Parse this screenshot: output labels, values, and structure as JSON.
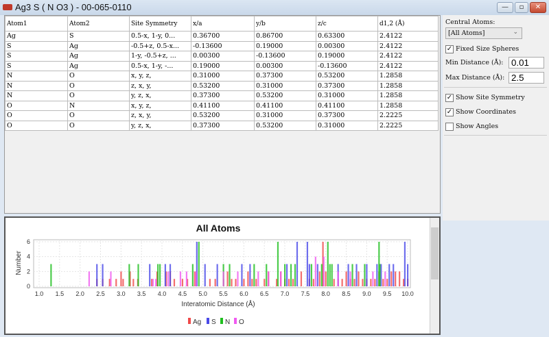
{
  "window": {
    "title": "Ag3 S ( N O3 ) - 00-065-0110",
    "minimize": "—",
    "maximize": "▫",
    "close": "✕"
  },
  "table": {
    "columns": [
      "Atom1",
      "Atom2",
      "Site Symmetry",
      "x/a",
      "y/b",
      "z/c",
      "d1,2 (Å)"
    ],
    "rows": [
      [
        "Ag",
        "S",
        "0.5-x, 1-y, 0...",
        "0.36700",
        "0.86700",
        "0.63300",
        "2.4122"
      ],
      [
        "S",
        "Ag",
        "-0.5+z, 0.5-x...",
        "-0.13600",
        "0.19000",
        "0.00300",
        "2.4122"
      ],
      [
        "S",
        "Ag",
        "1-y, -0.5+z, ...",
        "0.00300",
        "-0.13600",
        "0.19000",
        "2.4122"
      ],
      [
        "S",
        "Ag",
        "0.5-x, 1-y, -...",
        "0.19000",
        "0.00300",
        "-0.13600",
        "2.4122"
      ],
      [
        "N",
        "O",
        "x, y, z,",
        "0.31000",
        "0.37300",
        "0.53200",
        "1.2858"
      ],
      [
        "N",
        "O",
        "z, x, y,",
        "0.53200",
        "0.31000",
        "0.37300",
        "1.2858"
      ],
      [
        "N",
        "O",
        "y, z, x,",
        "0.37300",
        "0.53200",
        "0.31000",
        "1.2858"
      ],
      [
        "O",
        "N",
        "x, y, z,",
        "0.41100",
        "0.41100",
        "0.41100",
        "1.2858"
      ],
      [
        "O",
        "O",
        "z, x, y,",
        "0.53200",
        "0.31000",
        "0.37300",
        "2.2225"
      ],
      [
        "O",
        "O",
        "y, z, x,",
        "0.37300",
        "0.53200",
        "0.31000",
        "2.2225"
      ]
    ]
  },
  "panel": {
    "central_atoms_label": "Central Atoms:",
    "central_atoms_value": "[All Atoms]",
    "fixed_size_spheres": {
      "label": "Fixed Size Spheres",
      "checked": true
    },
    "min_distance_label": "Min Distance (Å):",
    "min_distance_value": "0.01",
    "max_distance_label": "Max Distance (Å):",
    "max_distance_value": "2.5",
    "show_site_symmetry": {
      "label": "Show Site Symmetry",
      "checked": true
    },
    "show_coordinates": {
      "label": "Show Coordinates",
      "checked": true
    },
    "show_angles": {
      "label": "Show Angles",
      "checked": false
    }
  },
  "chart_data": {
    "type": "bar",
    "title": "All Atoms",
    "xlabel": "Interatomic Distance (Å)",
    "ylabel": "Number",
    "xlim": [
      1.0,
      10.0
    ],
    "ylim": [
      0,
      6
    ],
    "xticks": [
      "1.0",
      "1.5",
      "2.0",
      "2.5",
      "3.0",
      "3.5",
      "4.0",
      "4.5",
      "5.0",
      "5.5",
      "6.0",
      "6.5",
      "7.0",
      "7.5",
      "8.0",
      "8.5",
      "9.0",
      "9.5",
      "10.0"
    ],
    "yticks": [
      "0",
      "2",
      "4",
      "6"
    ],
    "grid": true,
    "legend_position": "bottom",
    "series": [
      {
        "name": "Ag",
        "color": "#f04a4a",
        "points": [
          [
            2.41,
            1
          ],
          [
            2.55,
            1
          ],
          [
            2.72,
            1
          ],
          [
            2.88,
            1
          ],
          [
            3.0,
            2
          ],
          [
            3.05,
            1
          ],
          [
            3.22,
            2
          ],
          [
            3.3,
            1
          ],
          [
            3.41,
            1
          ],
          [
            3.75,
            1
          ],
          [
            3.88,
            2
          ],
          [
            4.1,
            2
          ],
          [
            4.2,
            2
          ],
          [
            4.3,
            1
          ],
          [
            4.5,
            1
          ],
          [
            4.62,
            1
          ],
          [
            4.8,
            2
          ],
          [
            5.17,
            1
          ],
          [
            5.3,
            1
          ],
          [
            5.5,
            1
          ],
          [
            5.6,
            2
          ],
          [
            5.7,
            1
          ],
          [
            5.8,
            1
          ],
          [
            6.0,
            1
          ],
          [
            6.1,
            2
          ],
          [
            6.2,
            1
          ],
          [
            6.3,
            1
          ],
          [
            6.5,
            1
          ],
          [
            6.6,
            2
          ],
          [
            6.8,
            1
          ],
          [
            6.9,
            2
          ],
          [
            7.0,
            1
          ],
          [
            7.1,
            1
          ],
          [
            7.2,
            1
          ],
          [
            7.4,
            2
          ],
          [
            7.6,
            1
          ],
          [
            7.7,
            1
          ],
          [
            7.85,
            2
          ],
          [
            7.93,
            6
          ],
          [
            8.0,
            2
          ],
          [
            8.2,
            1
          ],
          [
            8.3,
            1
          ],
          [
            8.4,
            1
          ],
          [
            8.5,
            2
          ],
          [
            8.6,
            1
          ],
          [
            8.7,
            1
          ],
          [
            8.8,
            2
          ],
          [
            8.9,
            1
          ],
          [
            9.0,
            1
          ],
          [
            9.1,
            1
          ],
          [
            9.2,
            1
          ],
          [
            9.3,
            2
          ],
          [
            9.4,
            1
          ],
          [
            9.5,
            1
          ],
          [
            9.6,
            2
          ],
          [
            9.7,
            2
          ],
          [
            9.8,
            2
          ],
          [
            9.9,
            1
          ],
          [
            10.0,
            1
          ]
        ]
      },
      {
        "name": "S",
        "color": "#4a4ae8",
        "points": [
          [
            2.41,
            3
          ],
          [
            2.55,
            3
          ],
          [
            3.7,
            3
          ],
          [
            4.08,
            3
          ],
          [
            4.2,
            3
          ],
          [
            4.85,
            6
          ],
          [
            5.05,
            3
          ],
          [
            5.35,
            3
          ],
          [
            5.95,
            3
          ],
          [
            6.15,
            3
          ],
          [
            7.05,
            3
          ],
          [
            7.3,
            6
          ],
          [
            7.55,
            6
          ],
          [
            7.6,
            3
          ],
          [
            7.8,
            3
          ],
          [
            8.3,
            3
          ],
          [
            8.55,
            3
          ],
          [
            8.75,
            3
          ],
          [
            9.0,
            3
          ],
          [
            9.25,
            3
          ],
          [
            9.35,
            3
          ],
          [
            9.55,
            3
          ],
          [
            9.65,
            3
          ],
          [
            9.93,
            6
          ],
          [
            10.0,
            3
          ]
        ]
      },
      {
        "name": "N",
        "color": "#1fbf1f",
        "points": [
          [
            1.29,
            3
          ],
          [
            3.2,
            3
          ],
          [
            3.42,
            3
          ],
          [
            3.9,
            3
          ],
          [
            3.95,
            3
          ],
          [
            4.75,
            3
          ],
          [
            4.9,
            6
          ],
          [
            5.5,
            3
          ],
          [
            5.65,
            3
          ],
          [
            6.25,
            3
          ],
          [
            6.55,
            3
          ],
          [
            6.83,
            6
          ],
          [
            7.0,
            3
          ],
          [
            7.15,
            3
          ],
          [
            7.25,
            3
          ],
          [
            7.65,
            3
          ],
          [
            7.9,
            3
          ],
          [
            8.05,
            6
          ],
          [
            8.1,
            3
          ],
          [
            8.15,
            3
          ],
          [
            8.65,
            3
          ],
          [
            8.95,
            3
          ],
          [
            9.3,
            6
          ],
          [
            9.32,
            3
          ]
        ]
      },
      {
        "name": "O",
        "color": "#f05af0",
        "points": [
          [
            2.22,
            2
          ],
          [
            2.75,
            2
          ],
          [
            3.78,
            1
          ],
          [
            3.85,
            1
          ],
          [
            4.15,
            2
          ],
          [
            4.45,
            2
          ],
          [
            4.6,
            2
          ],
          [
            4.83,
            2
          ],
          [
            5.5,
            2
          ],
          [
            5.85,
            2
          ],
          [
            6.35,
            2
          ],
          [
            6.6,
            2
          ],
          [
            6.9,
            2
          ],
          [
            7.75,
            4
          ],
          [
            7.95,
            4
          ],
          [
            8.3,
            2
          ],
          [
            8.6,
            2
          ],
          [
            9.15,
            2
          ],
          [
            9.45,
            2
          ]
        ]
      }
    ]
  }
}
